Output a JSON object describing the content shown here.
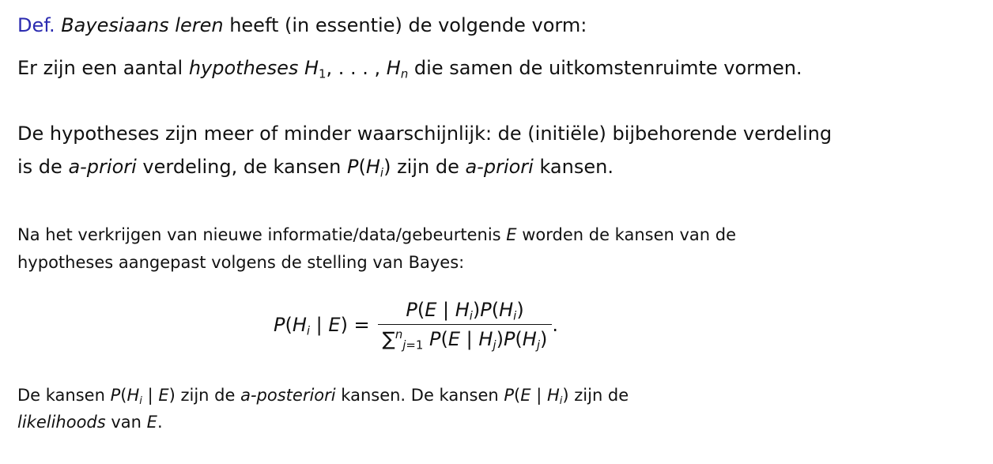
{
  "definition": {
    "prefix": "Def.",
    "term": "Bayesiaans leren",
    "rest": " heeft (in essentie) de volgende vorm:"
  },
  "hypotheses_line": {
    "text_before": "Er zijn een aantal ",
    "term": "hypotheses",
    "math": "H1, . . . , Hn",
    "text_after": " die samen de uitkomstenruimte vormen."
  },
  "prior": {
    "line1": "De hypotheses zijn meer of minder waarschijnlijk: de (initiële) bijbehorende verdeling",
    "line2_start": "is de ",
    "term1": "a-priori",
    "line2_mid": " verdeling, de kansen ",
    "math": "P(Hi)",
    "line2_mid2": " zijn de ",
    "term2": "a-priori",
    "line2_end": " kansen."
  },
  "update": {
    "line1_start": "Na het verkrijgen van nieuwe informatie/data/gebeurtenis ",
    "event": "E",
    "line1_end": " worden de kansen van de",
    "line2": "hypotheses aangepast volgens de stelling van Bayes:"
  },
  "formula": {
    "lhs": "P(Hi | E) =",
    "numerator": "P(E | Hi)P(Hi)",
    "denominator": "∑j=1n P(E | Hj)P(Hj)",
    "end": "."
  },
  "posterior": {
    "line1_start": "De kansen ",
    "math1": "P(Hi | E)",
    "line1_mid": " zijn de ",
    "term1": "a-posteriori",
    "line1_mid2": " kansen. De kansen ",
    "math2": "P(E | Hi)",
    "line1_end": " zijn de",
    "term2": "likelihoods",
    "line2_mid": " van ",
    "event": "E",
    "line2_end": "."
  }
}
